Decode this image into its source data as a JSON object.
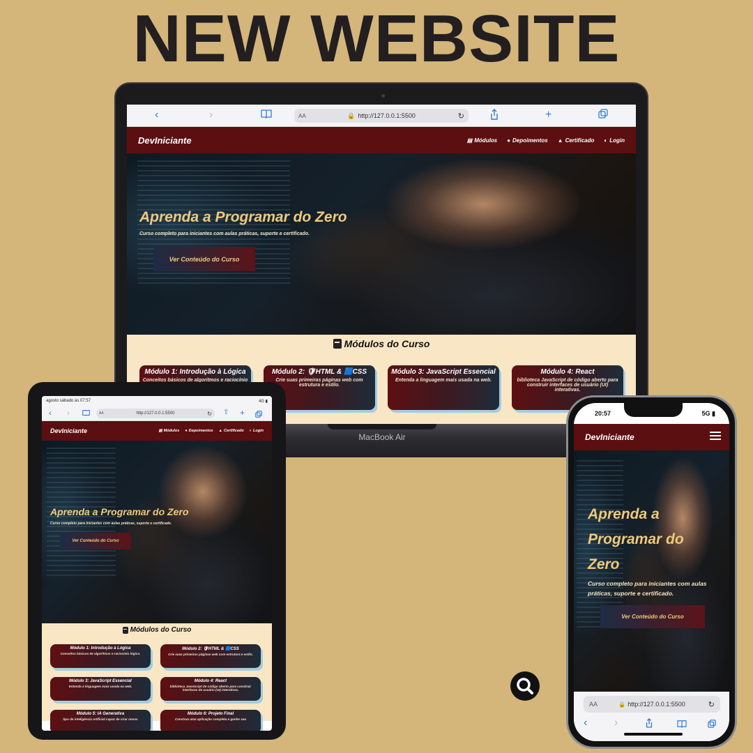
{
  "headline": "NEW WEBSITE",
  "brand_color": "#5b0f10",
  "accent_color": "#f0c97a",
  "background_color": "#d4b57a",
  "laptop": {
    "model_label": "MacBook Air",
    "browser": {
      "aa": "AA",
      "url": "http://127.0.0.1:5500"
    },
    "nav": {
      "brand": "DevIniciante",
      "links": [
        {
          "icon": "book-icon",
          "label": "Módulos"
        },
        {
          "icon": "chat-bubble-icon",
          "label": "Depoimentos"
        },
        {
          "icon": "graduation-cap-icon",
          "label": "Certificado"
        },
        {
          "icon": "user-icon",
          "label": "Login"
        }
      ]
    },
    "hero": {
      "title": "Aprenda a Programar do Zero",
      "subtitle": "Curso completo para iniciantes com aulas práticas, suporte e certificado.",
      "button": "Ver Conteúdo do Curso"
    },
    "modules_title": "Módulos do Curso",
    "cards": [
      {
        "title": "Módulo 1: Introdução à Lógica",
        "desc": "Conceitos básicos de algoritmos e raciocínio lógico."
      },
      {
        "title": "Módulo 2: 🛡HTML & 🟦CSS",
        "desc": "Crie suas primeiras páginas web com estrutura e estilo."
      },
      {
        "title": "Módulo 3: JavaScript Essencial",
        "desc": "Entenda a linguagem mais usada na web."
      },
      {
        "title": "Módulo 4: React",
        "desc": "biblioteca JavaScript de código aberto para construir interfaces de usuário (UI) interativas."
      }
    ]
  },
  "tablet": {
    "status_left": "agosto sábado às 07:57",
    "status_right": "4G ▮",
    "browser": {
      "aa": "AA",
      "url": "http://127.0.0.1:5500"
    },
    "nav": {
      "brand": "DevIniciante",
      "links": [
        {
          "icon": "book-icon",
          "label": "Módulos"
        },
        {
          "icon": "chat-bubble-icon",
          "label": "Depoimentos"
        },
        {
          "icon": "graduation-cap-icon",
          "label": "Certificado"
        },
        {
          "icon": "user-icon",
          "label": "Login"
        }
      ]
    },
    "hero": {
      "title": "Aprenda a Programar do Zero",
      "subtitle": "Curso completo para iniciantes com aulas práticas, suporte e certificado.",
      "button": "Ver Conteúdo do Curso"
    },
    "modules_title": "Módulos do Curso",
    "cards": [
      {
        "title": "Módulo 1: Introdução à Lógica",
        "desc": "Conceitos básicos de algoritmos e raciocínio lógico."
      },
      {
        "title": "Módulo 2: 🛡HTML & 🟦CSS",
        "desc": "Crie suas primeiras páginas web com estrutura e estilo."
      },
      {
        "title": "Módulo 3: JavaScript Essencial",
        "desc": "Entenda a linguagem mais usada na web."
      },
      {
        "title": "Módulo 4: React",
        "desc": "biblioteca JavaScript de código aberto para construir interfaces de usuário (UI) interativas."
      },
      {
        "title": "Módulo 5: IA Generativa",
        "desc": "tipo de inteligência artificial capaz de criar novos"
      },
      {
        "title": "Módulo 6: Projeto Final",
        "desc": "Construa uma aplicação completa e ganhe seu"
      }
    ]
  },
  "phone": {
    "time": "20:57",
    "signal": "5G",
    "nav": {
      "brand": "DevIniciante"
    },
    "hero": {
      "title": "Aprenda a Programar do Zero",
      "subtitle": "Curso completo para iniciantes com aulas práticas, suporte e certificado.",
      "button": "Ver Conteúdo do Curso"
    },
    "browser": {
      "aa": "AA",
      "url": "http://127.0.0.1:5500"
    }
  }
}
